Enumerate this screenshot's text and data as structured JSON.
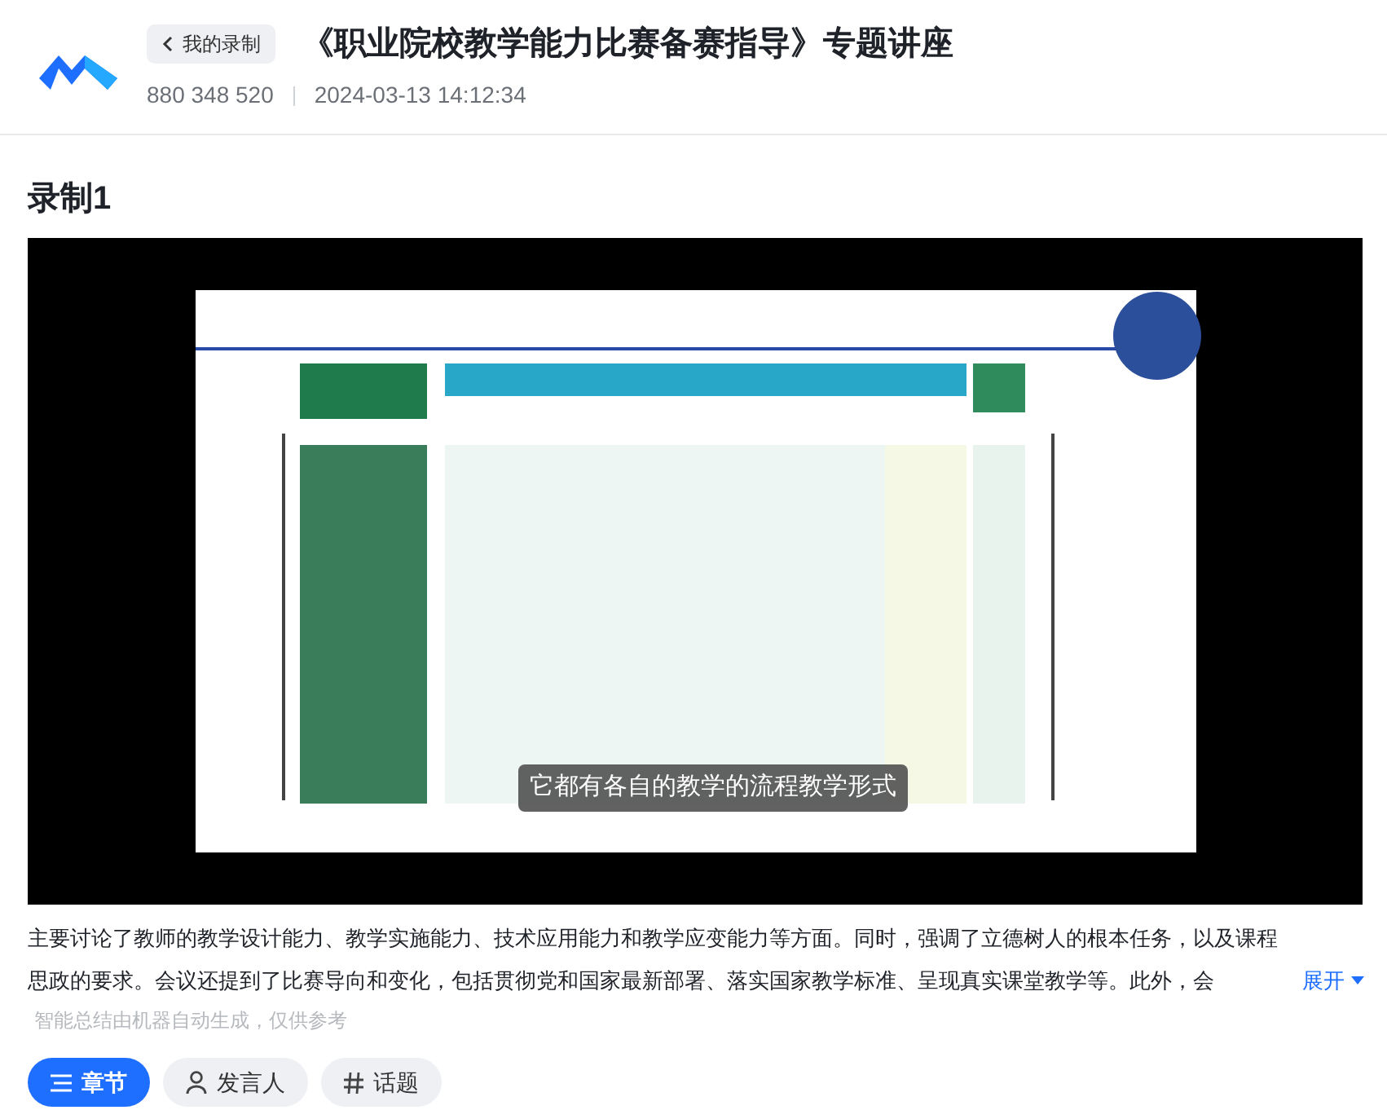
{
  "header": {
    "back_link": "我的录制",
    "title": "《职业院校教学能力比赛备赛指导》专题讲座",
    "meeting_id": "880 348 520",
    "datetime": "2024-03-13 14:12:34"
  },
  "recording": {
    "title": "录制1",
    "video": {
      "kind": "picture",
      "caption": "它都有各自的教学的流程教学形式"
    }
  },
  "summary": {
    "text": "主要讨论了教师的教学设计能力、教学实施能力、技术应用能力和教学应变能力等方面。同时，强调了立德树人的根本任务，以及课程思政的要求。会议还提到了比赛导向和变化，包括贯彻党和国家最新部署、落实国家教学标准、呈现真实课堂教学等。此外，会",
    "expand": "展开",
    "note": "智能总结由机器自动生成，仅供参考"
  },
  "tabs": [
    {
      "label": "章节",
      "kind": "list",
      "selected": true
    },
    {
      "label": "发言人",
      "kind": "person",
      "selected": false
    },
    {
      "label": "话题",
      "kind": "hash",
      "selected": false
    }
  ]
}
